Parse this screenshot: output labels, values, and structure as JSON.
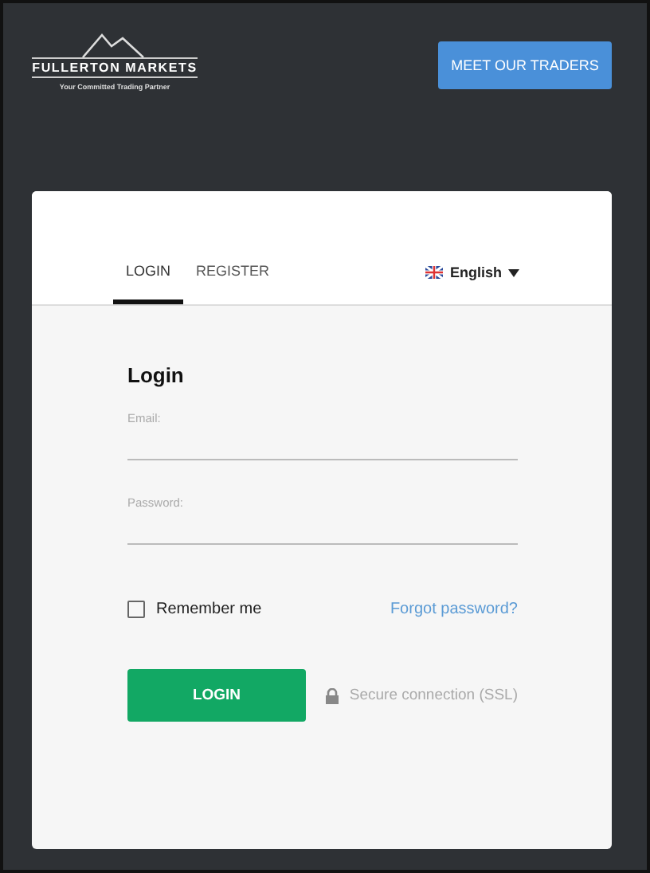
{
  "header": {
    "logo_name": "FULLERTON MARKETS",
    "logo_tagline": "Your Committed Trading Partner",
    "cta_button": "MEET OUR TRADERS"
  },
  "tabs": [
    {
      "label": "LOGIN",
      "selected": true
    },
    {
      "label": "REGISTER",
      "selected": false
    }
  ],
  "language": {
    "label": "English"
  },
  "form": {
    "title": "Login",
    "fields": [
      {
        "label": "Email:"
      },
      {
        "label": "Password:"
      }
    ],
    "remember": {
      "label": "Remember me",
      "checked": false
    },
    "forgot_link": "Forgot password?",
    "submit": "LOGIN",
    "secure_note": "Secure connection (SSL)"
  }
}
